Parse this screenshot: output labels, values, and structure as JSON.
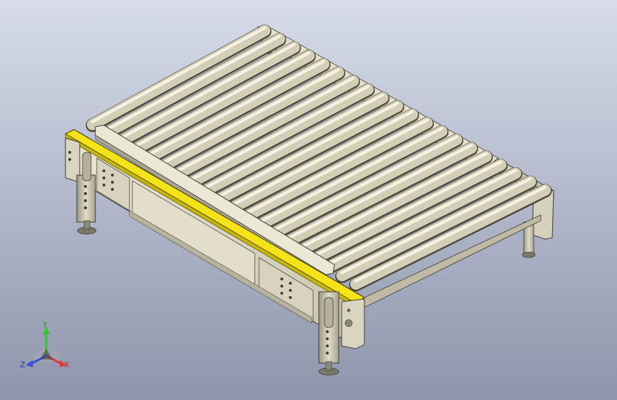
{
  "viewport": {
    "background_top": "#d7dcea",
    "background_bottom": "#8e95ab"
  },
  "model": {
    "frame_color": "#dcd8c4",
    "roller_color": "#d3ceb6",
    "highlight_edge_color": "#f4e21a",
    "roller_count": 20
  },
  "triad": {
    "y_label": "Y",
    "z_label": "Z",
    "x_label": "X",
    "y_color": "#3dbf3d",
    "z_color": "#3b4fd8",
    "x_color": "#d83b3b"
  }
}
